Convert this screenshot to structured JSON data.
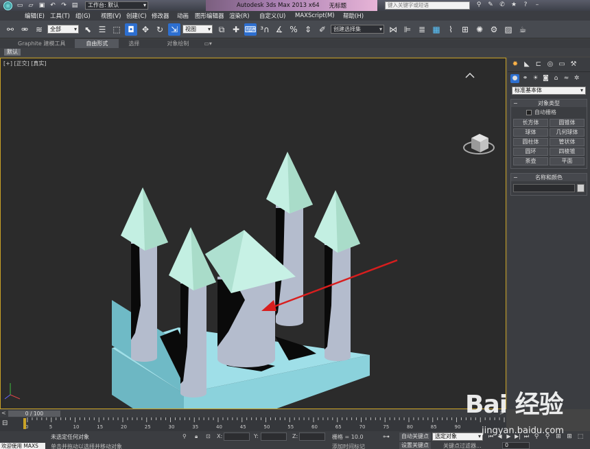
{
  "titlebar": {
    "workspace_label": "工作台: 默认",
    "app_title": "Autodesk 3ds Max  2013 x64",
    "doc_title": "无标题",
    "search_placeholder": "键入关键字或短语"
  },
  "menu": [
    "编辑(E)",
    "工具(T)",
    "组(G)",
    "视图(V)",
    "创建(C)",
    "修改器",
    "动画",
    "图形编辑器",
    "渲染(R)",
    "自定义(U)",
    "MAXScript(M)",
    "帮助(H)"
  ],
  "toolbar": {
    "selection_filter": "全部",
    "reference_coord": "视图",
    "named_selection": "创建选择集"
  },
  "ribbon": {
    "tabs": [
      "Graphite 建模工具",
      "自由形式",
      "选择",
      "对象绘制"
    ],
    "active_tab": "自由形式",
    "sub_tab": "默认"
  },
  "viewport": {
    "label": "[+] [正交] [真实]"
  },
  "command_panel": {
    "category": "标准基本体",
    "object_type_title": "对象类型",
    "autogrid_label": "自动栅格",
    "objects": [
      "长方体",
      "圆锥体",
      "球体",
      "几何球体",
      "圆柱体",
      "管状体",
      "圆环",
      "四棱锥",
      "茶壶",
      "平面"
    ],
    "name_color_title": "名称和颜色"
  },
  "timeline": {
    "frame_readout": "0 / 100",
    "ticks": [
      "0",
      "5",
      "10",
      "15",
      "20",
      "25",
      "30",
      "35",
      "40",
      "45",
      "50",
      "55",
      "60",
      "65",
      "70",
      "75",
      "80",
      "85",
      "90"
    ]
  },
  "status": {
    "welcome": "欢迎使用 MAXS",
    "selection_status": "未选定任何对象",
    "hint": "单击并拖动以选择并移动对象",
    "x_label": "X:",
    "y_label": "Y:",
    "z_label": "Z:",
    "grid": "栅格 = 10.0",
    "add_time_tag": "添加时间标记",
    "auto_key": "自动关键点",
    "selection_set": "选定对象",
    "set_key": "设置关键点",
    "key_filter": "关键点过滤器...",
    "current_frame": "0"
  },
  "watermark": {
    "brand": "Bai  经验",
    "domain": "jingyan.baidu.com"
  },
  "colors": {
    "viewport_bg": "#2b2b2b",
    "base_color": "#8fd6e0",
    "cylinder_color": "#aeb6c8",
    "roof_color": "#bff0e0",
    "arrow_color": "#d81e1e",
    "active_frame": "#c9a227"
  }
}
